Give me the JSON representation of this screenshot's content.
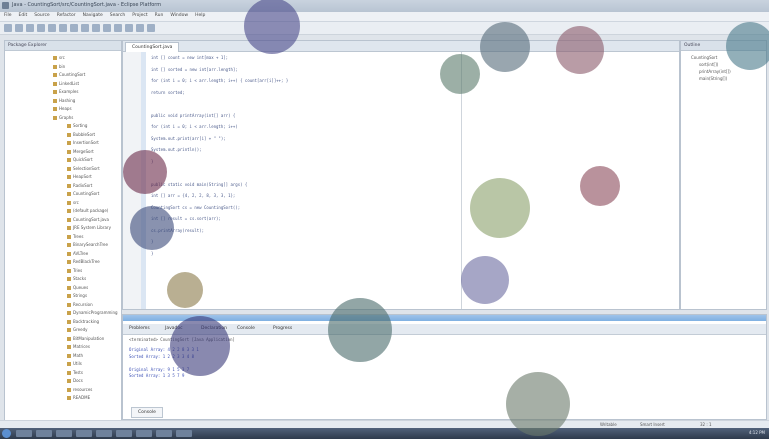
{
  "window": {
    "title": "Java - CountingSort/src/CountingSort.java - Eclipse Platform"
  },
  "menu": [
    "File",
    "Edit",
    "Source",
    "Refactor",
    "Navigate",
    "Search",
    "Project",
    "Run",
    "Window",
    "Help"
  ],
  "explorer": {
    "title": "Package Explorer",
    "items": [
      "src",
      "bin",
      "CountingSort",
      "LinkedList",
      "Examples",
      "Hashing",
      "Heaps",
      "Graphs",
      "Sorting",
      "BubbleSort",
      "InsertionSort",
      "MergeSort",
      "QuickSort",
      "SelectionSort",
      "HeapSort",
      "RadixSort",
      "CountingSort",
      "src",
      "(default package)",
      "CountingSort.java",
      "JRE System Library",
      "Trees",
      "BinarySearchTree",
      "AVLTree",
      "RedBlackTree",
      "Tries",
      "Stacks",
      "Queues",
      "Strings",
      "Recursion",
      "DynamicProgramming",
      "Backtracking",
      "Greedy",
      "BitManipulation",
      "Matrices",
      "Math",
      "Utils",
      "Tests",
      "Docs",
      "resources",
      "README"
    ]
  },
  "editor": {
    "tab": "CountingSort.java",
    "code_lines": [
      "        int [] count = new int[max + 1];",
      "        int [] sorted = new int[arr.length];",
      "        for (int i = 0; i < arr.length; i++) { count[arr[i]]++; }",
      "        return sorted;",
      "",
      "    public void printArray(int[] arr) {",
      "        for (int i = 0; i < arr.length; i++)",
      "            System.out.print(arr[i] + \" \");",
      "        System.out.println();",
      "    }",
      "",
      "    public static void main(String[] args) {",
      "        int [] arr = {4, 2, 2, 8, 3, 3, 1};",
      "        CountingSort cs = new CountingSort();",
      "        int [] result = cs.sort(arr);",
      "        cs.printArray(result);",
      "    }",
      "}"
    ]
  },
  "outline": {
    "title": "Outline",
    "items": [
      "CountingSort",
      "sort(int[])",
      "printArray(int[])",
      "main(String[])"
    ]
  },
  "console": {
    "tabs": [
      "Problems",
      "Javadoc",
      "Declaration",
      "Console",
      "Progress"
    ],
    "header": "<terminated> CountingSort [Java Application]",
    "lines": [
      "Original Array: 4 2 2 8 3 3 1",
      "Sorted Array: 1 2 2 3 3 4 8",
      "",
      "Original Array: 9 1 5 3 7",
      "Sorted Array: 1 3 5 7 9"
    ],
    "bottom_tab": "Console"
  },
  "status": {
    "mode": "Writable",
    "insert": "Smart Insert",
    "position": "32 : 1"
  },
  "taskbar": {
    "clock": "4:12 PM"
  },
  "colors": {
    "accent": "#7fb0e2",
    "code": "#4a5a8a",
    "console_text": "#3b4fb5"
  }
}
